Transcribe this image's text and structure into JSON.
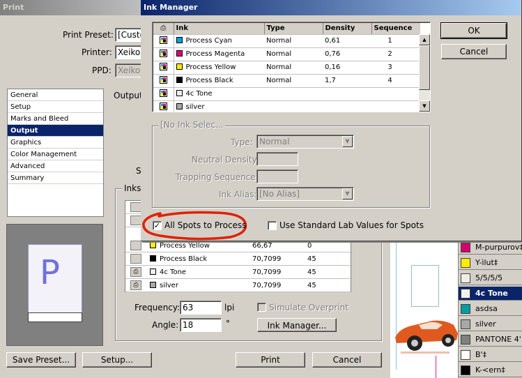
{
  "print_dialog": {
    "title": "Print",
    "print_preset_label": "Print Preset:",
    "print_preset_value": "[Custo",
    "printer_label": "Printer:",
    "printer_value": "Xeikor",
    "ppd_label": "PPD:",
    "ppd_value": "Xeikor",
    "nav": [
      "General",
      "Setup",
      "Marks and Bleed",
      "Output",
      "Graphics",
      "Color Management",
      "Advanced",
      "Summary"
    ],
    "nav_selected": "Output",
    "section_label": "Output",
    "inks_group_label": "Inks",
    "s_fragment": "S",
    "inks": [
      {
        "name": "Process Yellow",
        "frequency": "66,67",
        "angle": "0",
        "color": "#ffed00",
        "icon": "none"
      },
      {
        "name": "Process Black",
        "frequency": "70,7099",
        "angle": "45",
        "color": "#000000",
        "icon": "none"
      },
      {
        "name": "4c Tone",
        "frequency": "70,7099",
        "angle": "45",
        "color": "#f0f0f0",
        "icon": "printer-icon"
      },
      {
        "name": "silver",
        "frequency": "70,7099",
        "angle": "45",
        "color": "#a8a8a8",
        "icon": "printer-icon"
      }
    ],
    "frequency_label": "Frequency:",
    "frequency_value": "63",
    "frequency_unit": "lpi",
    "angle_label": "Angle:",
    "angle_value": "18",
    "angle_unit": "°",
    "simulate_overprint_label": "Simulate Overprint",
    "ink_manager_button": "Ink Manager...",
    "preview_letter": "P",
    "save_preset_button": "Save Preset...",
    "setup_button": "Setup...",
    "print_button": "Print",
    "cancel_button": "Cancel"
  },
  "ink_manager": {
    "title": "Ink Manager",
    "columns": [
      "Ink",
      "Type",
      "Density",
      "Sequence"
    ],
    "rows": [
      {
        "ink": "Process Cyan",
        "type": "Normal",
        "density": "0,61",
        "sequence": "1",
        "color": "#00a0e0"
      },
      {
        "ink": "Process Magenta",
        "type": "Normal",
        "density": "0,76",
        "sequence": "2",
        "color": "#e0007a"
      },
      {
        "ink": "Process Yellow",
        "type": "Normal",
        "density": "0,16",
        "sequence": "3",
        "color": "#ffed00"
      },
      {
        "ink": "Process Black",
        "type": "Normal",
        "density": "1,7",
        "sequence": "4",
        "color": "#000000"
      },
      {
        "ink": "4c Tone",
        "type": "",
        "density": "",
        "sequence": "",
        "color": "#f0f0f0"
      },
      {
        "ink": "silver",
        "type": "",
        "density": "",
        "sequence": "",
        "color": "#a8a8a8"
      }
    ],
    "ok_button": "OK",
    "cancel_button": "Cancel",
    "group_label": "[No Ink Selec...",
    "type_label": "Type:",
    "type_value": "Normal",
    "neutral_density_label": "Neutral Density:",
    "trapping_sequence_label": "Trapping Sequence:",
    "ink_alias_label": "Ink Alias:",
    "ink_alias_value": "[No Alias]",
    "all_spots_label": "All Spots to Process",
    "all_spots_checked": true,
    "lab_values_label": "Use Standard Lab Values for Spots",
    "lab_values_checked": false,
    "highlight_color": "#e02000"
  },
  "swatches_panel": {
    "items": [
      {
        "name": "M-purpurov‡",
        "color": "#d4006f",
        "selected": false
      },
      {
        "name": "Y-ìlut‡",
        "color": "#ffed00",
        "selected": false
      },
      {
        "name": "5/5/5/5",
        "color": "#f0ece8",
        "selected": false
      },
      {
        "name": "4c Tone",
        "color": "#f0f0f0",
        "selected": true
      },
      {
        "name": "asdsa",
        "color": "#009ea0",
        "selected": false
      },
      {
        "name": "silver",
        "color": "#a8a8a8",
        "selected": false
      },
      {
        "name": "PANTONE 4'",
        "color": "#808080",
        "selected": false
      },
      {
        "name": "B'‡",
        "color": "#ffffff",
        "selected": false
      },
      {
        "name": "K-<ern‡",
        "color": "#000000",
        "selected": false
      }
    ]
  }
}
